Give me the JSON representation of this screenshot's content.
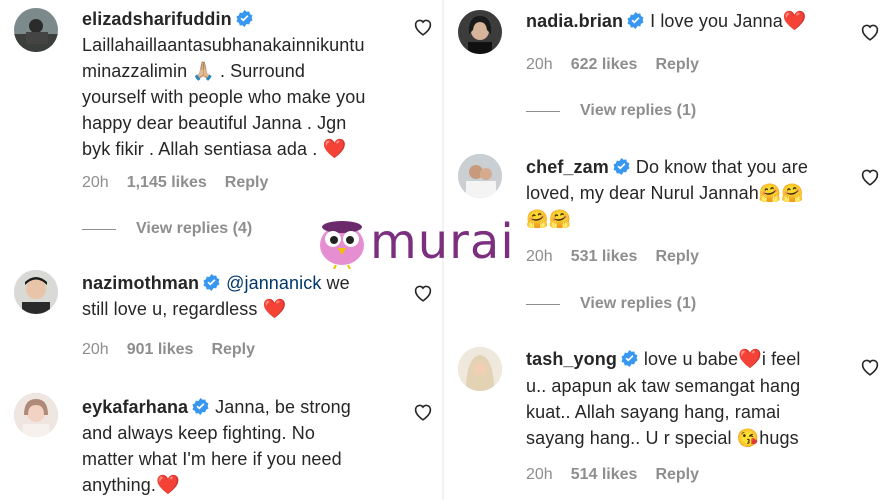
{
  "watermark": {
    "text": "murai"
  },
  "comments": [
    {
      "username": "elizadsharifuddin",
      "text": "Laillahaillaantasubhanakainnikuntu minazzalimin 🙏🏼 . Surround yourself with people who make you happy dear beautiful Janna . Jgn byk fikir . Allah sentiasa ada . ",
      "lines": [
        "Laillahaillaantasubhanakainnikuntu",
        "minazzalimin",
        ". Surround",
        "yourself with people who make you",
        "happy dear beautiful Janna . Jgn",
        "byk fikir . Allah sentiasa ada ."
      ],
      "time": "20h",
      "likes": "1,145 likes",
      "reply": "Reply",
      "view_replies": "View replies (4)"
    },
    {
      "username": "nazimothman",
      "mention": "@jannanick",
      "line1_tail": "we",
      "line2": "still love u, regardless",
      "time": "20h",
      "likes": "901 likes",
      "reply": "Reply"
    },
    {
      "username": "eykafarhana",
      "line1_tail": "Janna, be strong",
      "lines": [
        "and always keep fighting. No",
        "matter what I'm here if you need",
        "anything."
      ]
    },
    {
      "username": "nadia.brian",
      "line1_tail": "I love you Janna",
      "time": "20h",
      "likes": "622 likes",
      "reply": "Reply",
      "view_replies": "View replies (1)"
    },
    {
      "username": "chef_zam",
      "line1_tail": "Do know that you are",
      "line2": "loved, my dear Nurul Jannah",
      "time": "20h",
      "likes": "531 likes",
      "reply": "Reply",
      "view_replies": "View replies (1)"
    },
    {
      "username": "tash_yong",
      "line1_tail": "love u babe",
      "line1_end": "i feel",
      "lines": [
        "u.. apapun ak taw semangat hang",
        "kuat.. Allah sayang hang, ramai",
        "sayang hang.. U r special"
      ],
      "line_end": "hugs",
      "time": "20h",
      "likes": "514 likes",
      "reply": "Reply"
    }
  ],
  "emoji": {
    "heart": "❤️",
    "pray": "🙏🏼",
    "hug": "🤗",
    "kiss": "😘"
  },
  "colors": {
    "verified": "#3897f0",
    "muted": "#8e8e8e",
    "heart": "#e0243b",
    "brand": "#7b2f7e"
  }
}
